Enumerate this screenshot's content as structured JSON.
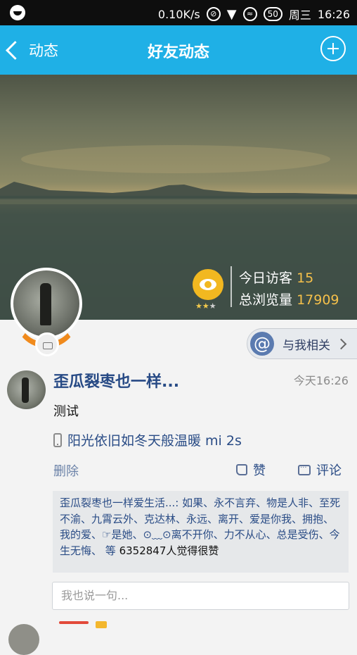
{
  "status_bar": {
    "speed": "0.10K/s",
    "battery": "50",
    "day": "周三",
    "time": "16:26"
  },
  "header": {
    "back_label": "动态",
    "title": "好友动态"
  },
  "cover": {
    "visitors_label": "今日访客",
    "visitors_value": "15",
    "views_label": "总浏览量",
    "views_value": "17909",
    "stars_filled": 2,
    "stars_total": 3
  },
  "related_label": "与我相关",
  "post": {
    "author": "歪瓜裂枣也一样...",
    "time": "今天16:26",
    "text": "测试",
    "device": "阳光依旧如冬天般温暖 mi 2s",
    "delete_label": "删除",
    "like_label": "赞",
    "comment_label": "评论",
    "likes_names": "歪瓜裂枣也一样爱生活...: 如果、永不言弃、物是人非、至死不渝、九霄云外、克达林、永远、离开、爱是你我、拥抱、我的爱、☞是她、⊙﹏⊙离不开你、力不从心、总是受伤、今生无悔、 等",
    "likes_count_text": "6352847人觉得很赞",
    "reply_placeholder": "我也说一句..."
  },
  "colors": {
    "header_bg": "#1fb0e6",
    "accent_orange": "#f08a1c",
    "link_blue": "#2a4c86",
    "highlight_gold": "#f5c04a"
  }
}
